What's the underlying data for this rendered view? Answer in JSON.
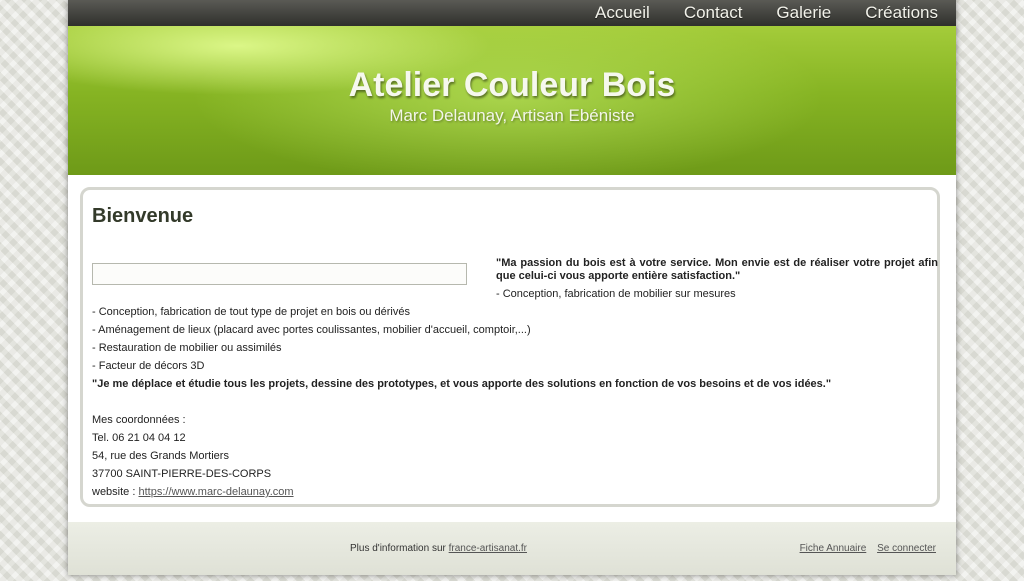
{
  "nav": {
    "items": [
      {
        "label": "Accueil"
      },
      {
        "label": "Contact"
      },
      {
        "label": "Galerie"
      },
      {
        "label": "Créations"
      }
    ]
  },
  "header": {
    "title": "Atelier Couleur Bois",
    "subtitle": "Marc Delaunay, Artisan Ebéniste"
  },
  "main": {
    "title": "Bienvenue",
    "quote_top": "\"Ma passion du bois est à votre service. Mon envie est de réaliser votre projet afin que celui-ci vous apporte entière satisfaction.\"",
    "services": [
      "- Conception, fabrication de mobilier sur mesures",
      "- Conception, fabrication de tout type de projet en bois ou dérivés",
      "- Aménagement de lieux (placard avec portes coulissantes, mobilier d'accueil, comptoir,...)",
      "- Restauration de mobilier ou assimilés",
      "- Facteur de décors 3D"
    ],
    "quote_bottom": "\"Je me déplace et étudie tous les projets, dessine des prototypes, et vous apporte des solutions en fonction de vos besoins et de vos idées.\"",
    "contact": {
      "heading": "Mes coordonnées :",
      "phone": "Tel. 06 21 04 04 12",
      "street": "54, rue des Grands Mortiers",
      "city": "37700 SAINT-PIERRE-DES-CORPS",
      "website_label": "website :",
      "website_url": "https://www.marc-delaunay.com"
    }
  },
  "footer": {
    "info_text": "Plus d'information sur",
    "info_link": "france-artisanat.fr",
    "links": [
      {
        "label": "Fiche Annuaire"
      },
      {
        "label": "Se connecter"
      }
    ]
  }
}
